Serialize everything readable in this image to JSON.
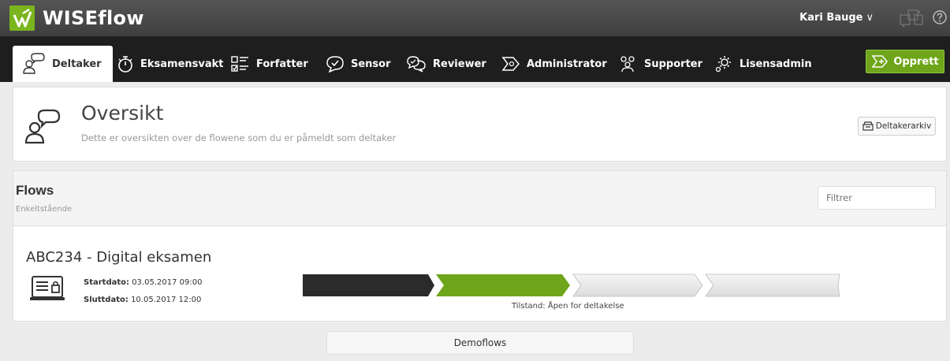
{
  "header": {
    "app_name": "WISEflow",
    "user_name": "Kari Bauge",
    "user_caret": "∨",
    "icons": [
      "wiseflow-logo-icon",
      "apps-grid-icon",
      "help-icon"
    ]
  },
  "nav": {
    "tabs": [
      {
        "label": "Deltaker",
        "icon": "participant-icon",
        "active": true
      },
      {
        "label": "Eksamensvakt",
        "icon": "stopwatch-icon",
        "active": false
      },
      {
        "label": "Forfatter",
        "icon": "checklist-icon",
        "active": false
      },
      {
        "label": "Sensor",
        "icon": "assessor-check-icon",
        "active": false
      },
      {
        "label": "Reviewer",
        "icon": "reviewer-icon",
        "active": false
      },
      {
        "label": "Administrator",
        "icon": "administrator-icon",
        "active": false
      },
      {
        "label": "Supporter",
        "icon": "supporter-icon",
        "active": false
      },
      {
        "label": "Lisensadmin",
        "icon": "license-gear-icon",
        "active": false
      }
    ],
    "create_label": "Opprett"
  },
  "overview": {
    "title": "Oversikt",
    "subtitle": "Dette er oversikten over de flowene som du er påmeldt som deltaker",
    "archive_label": "Deltakerarkiv"
  },
  "flows": {
    "title": "Flows",
    "subtitle": "Enkeltstående",
    "filter_placeholder": "Filtrer",
    "items": [
      {
        "title": "ABC234 - Digital eksamen",
        "start_label": "Startdato:",
        "start_value": "03.05.2017 09:00",
        "end_label": "Sluttdato:",
        "end_value": "10.05.2017 12:00",
        "state_text": "Tilstand: Åpen for deltakelse"
      }
    ],
    "demoflows_label": "Demoflows"
  },
  "colors": {
    "brand_green": "#7ab51d",
    "create_green": "#6fa51a",
    "topbar": "#4a4a4a",
    "navbar": "#1e1e1e",
    "stage_done": "#2a2a2a",
    "stage_active": "#6fa51a",
    "stage_pending": "#e4e4e4"
  }
}
